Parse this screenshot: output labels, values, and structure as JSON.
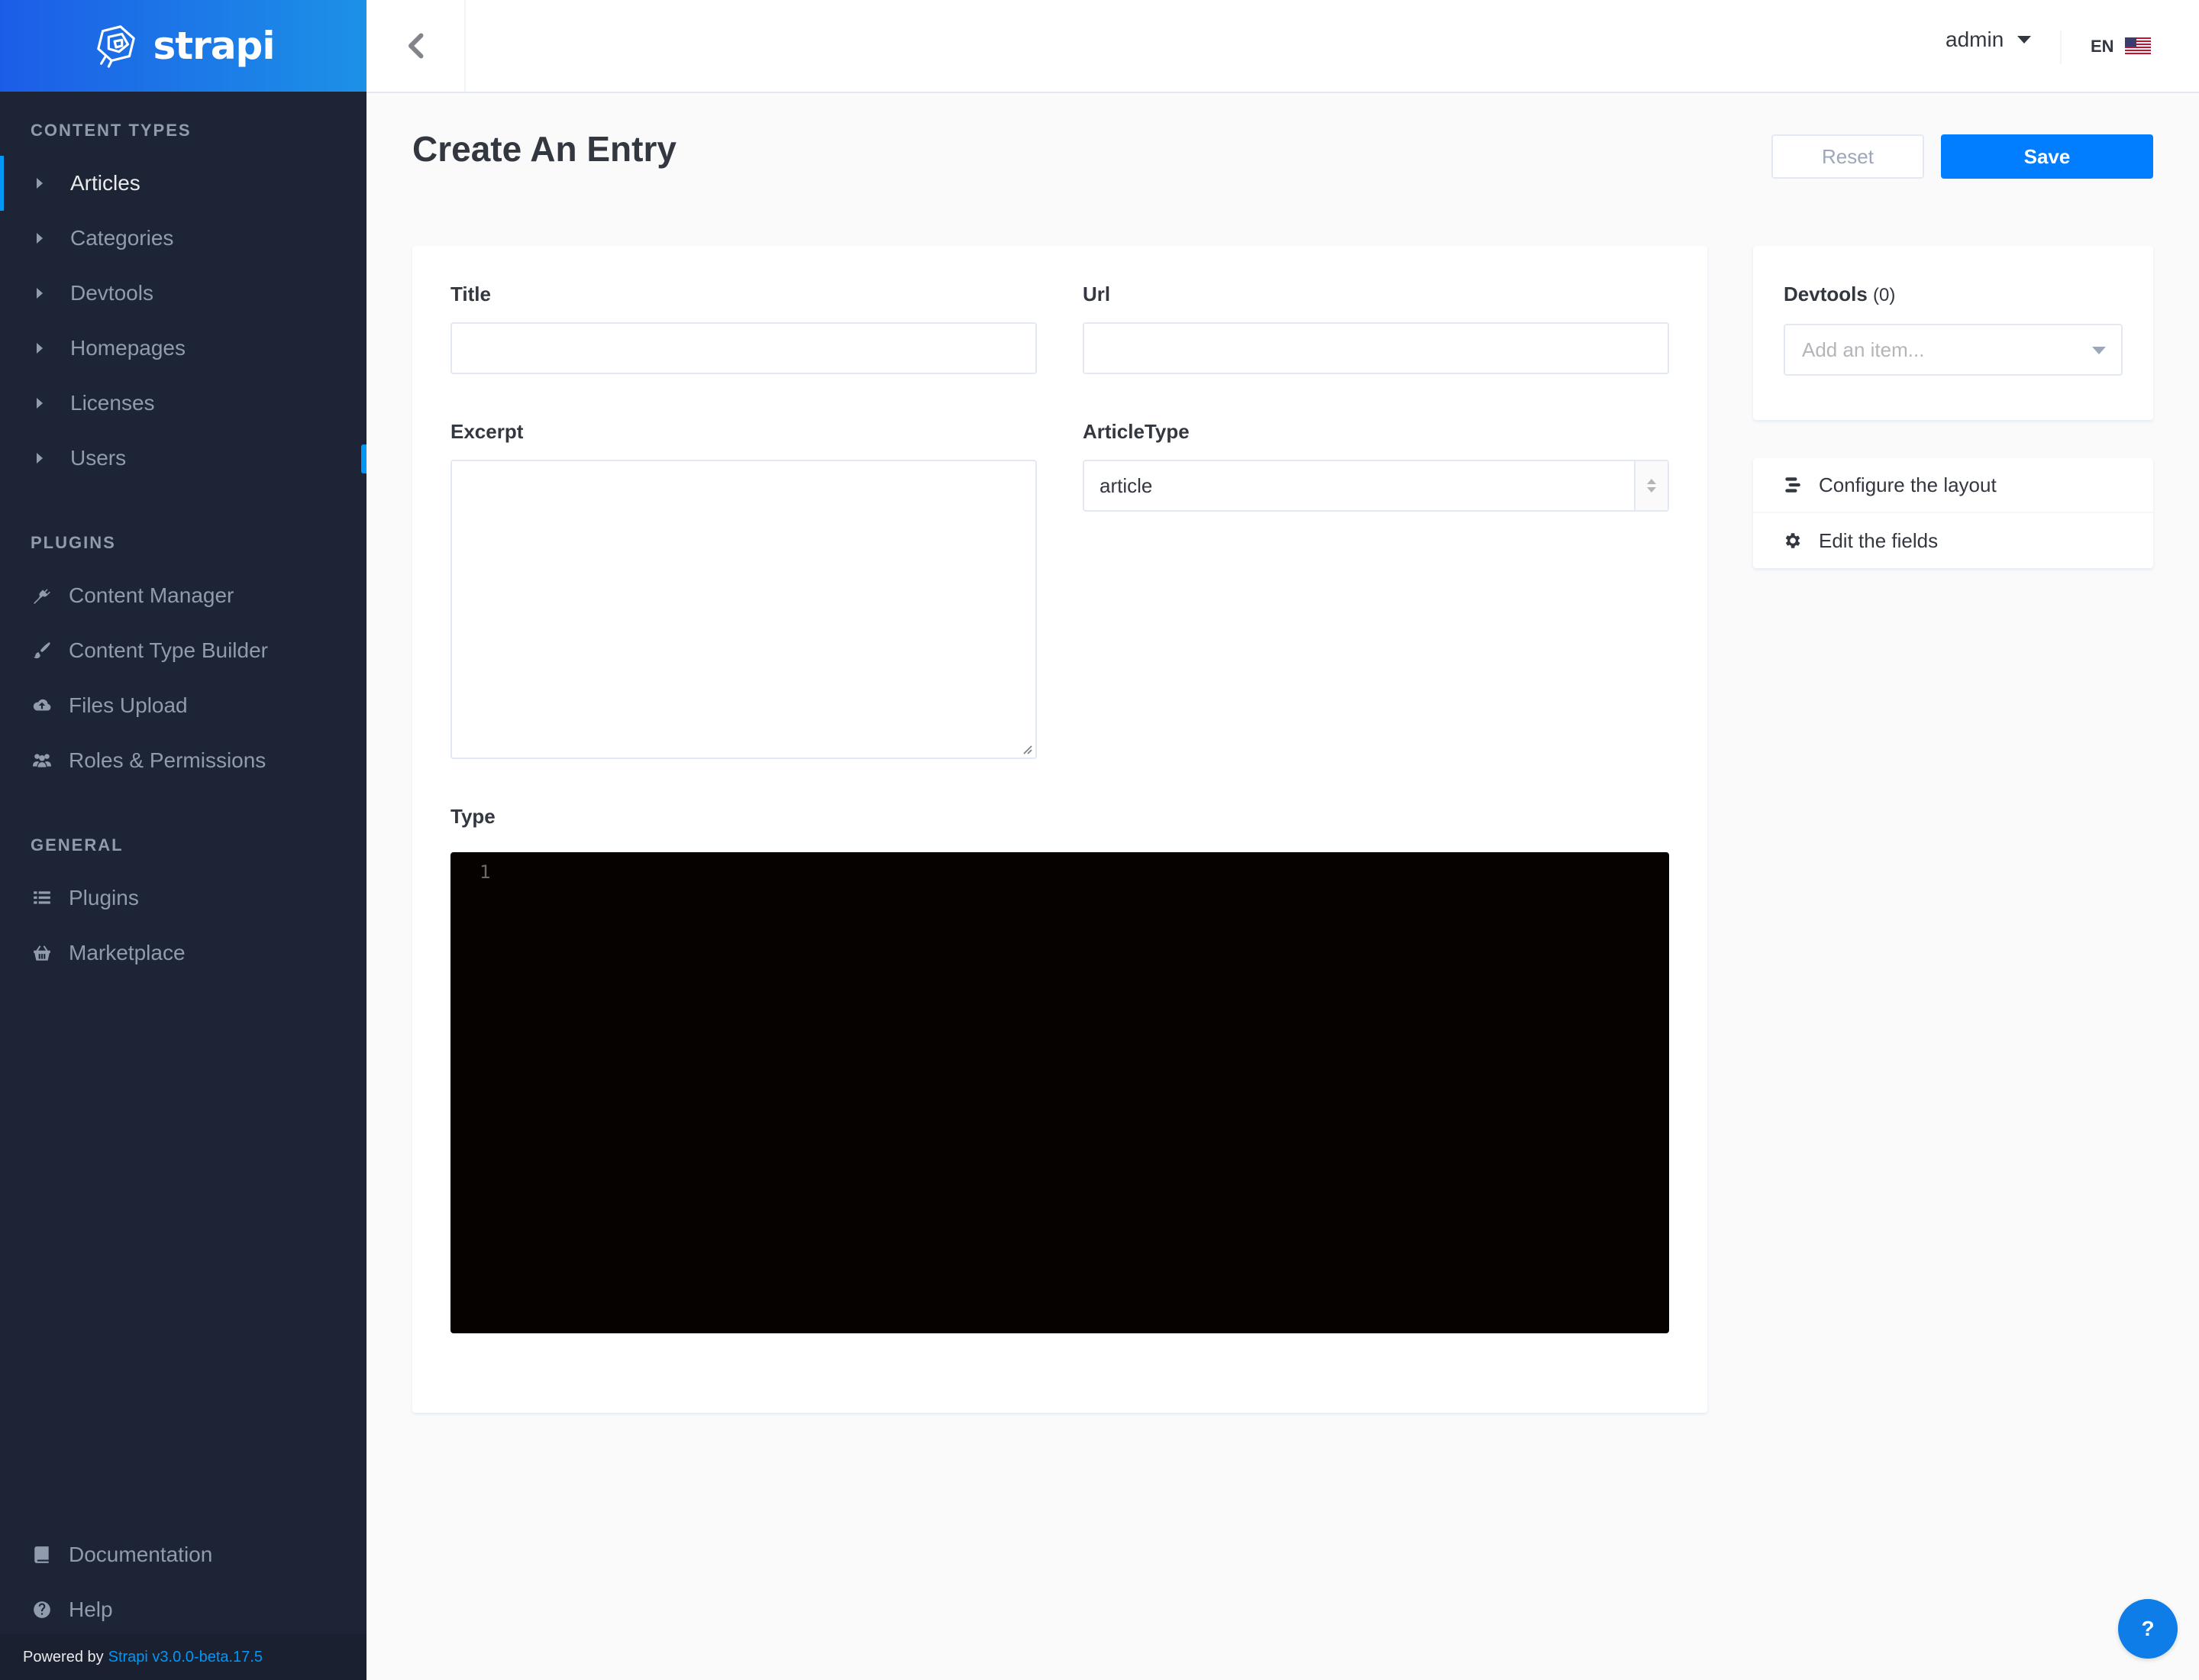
{
  "brand": {
    "name": "strapi"
  },
  "sidebar": {
    "content_types_title": "Content Types",
    "content_types": [
      {
        "label": "Articles",
        "active": true
      },
      {
        "label": "Categories"
      },
      {
        "label": "Devtools"
      },
      {
        "label": "Homepages"
      },
      {
        "label": "Licenses"
      },
      {
        "label": "Users"
      }
    ],
    "plugins_title": "Plugins",
    "plugins": [
      {
        "label": "Content Manager",
        "icon": "plug-icon"
      },
      {
        "label": "Content Type Builder",
        "icon": "brush-icon"
      },
      {
        "label": "Files Upload",
        "icon": "cloud-upload-icon"
      },
      {
        "label": "Roles & Permissions",
        "icon": "users-icon"
      }
    ],
    "general_title": "General",
    "general": [
      {
        "label": "Plugins",
        "icon": "list-icon"
      },
      {
        "label": "Marketplace",
        "icon": "basket-icon"
      }
    ],
    "footer": [
      {
        "label": "Documentation",
        "icon": "book-icon"
      },
      {
        "label": "Help",
        "icon": "question-circle-icon"
      }
    ],
    "powered_by": "Powered by",
    "version": "Strapi v3.0.0-beta.17.5"
  },
  "header": {
    "user": "admin",
    "language": "EN"
  },
  "main": {
    "title": "Create An Entry",
    "reset_label": "Reset",
    "save_label": "Save",
    "fields": {
      "title_label": "Title",
      "title_value": "",
      "url_label": "Url",
      "url_value": "",
      "excerpt_label": "Excerpt",
      "excerpt_value": "",
      "article_type_label": "ArticleType",
      "article_type_value": "article",
      "type_label": "Type",
      "type_line_number": "1"
    }
  },
  "right_panel": {
    "devtools_title": "Devtools",
    "devtools_count": "(0)",
    "devtools_placeholder": "Add an item...",
    "configure_layout": "Configure the layout",
    "edit_fields": "Edit the fields"
  },
  "help_button": "?",
  "colors": {
    "brand_gradient_start": "#1c5de7",
    "brand_gradient_end": "#1c91e7",
    "sidebar_bg": "#1d2435",
    "accent": "#007eff",
    "active_indicator": "#0097f7"
  }
}
